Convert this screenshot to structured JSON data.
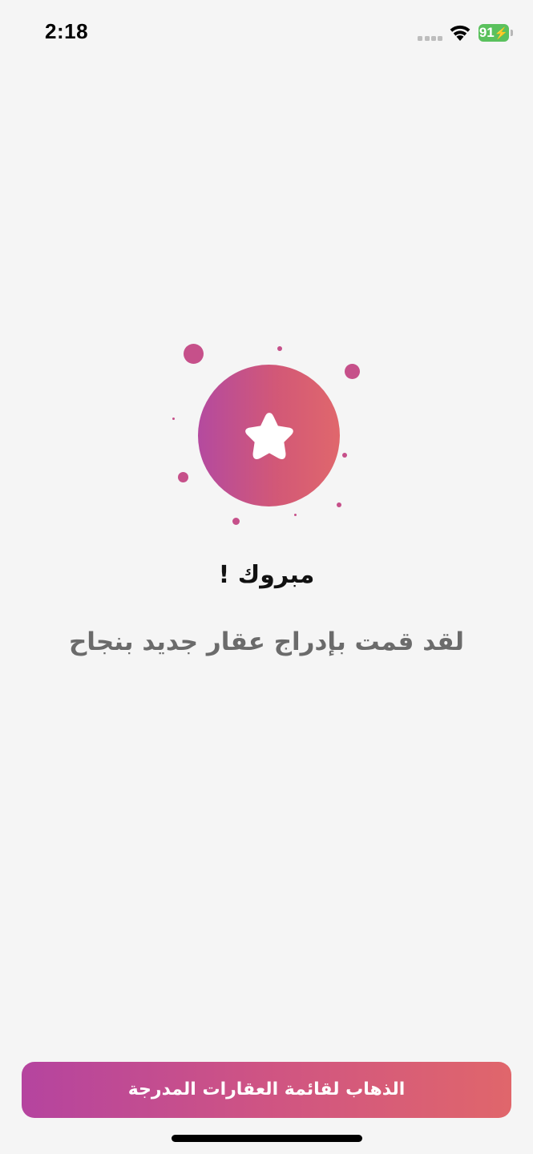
{
  "status_bar": {
    "time": "2:18",
    "battery_level": "91",
    "charging": true,
    "battery_color": "#5ac15d"
  },
  "illustration": {
    "icon": "star-icon",
    "gradient_start": "#b44a9f",
    "gradient_end": "#e0676c",
    "dot_color": "#c6508a"
  },
  "content": {
    "title": "مبروك !",
    "subtitle": "لقد قمت بإدراج عقار جديد بنجاح"
  },
  "actions": {
    "primary_label": "الذهاب لقائمة العقارات المدرجة"
  }
}
